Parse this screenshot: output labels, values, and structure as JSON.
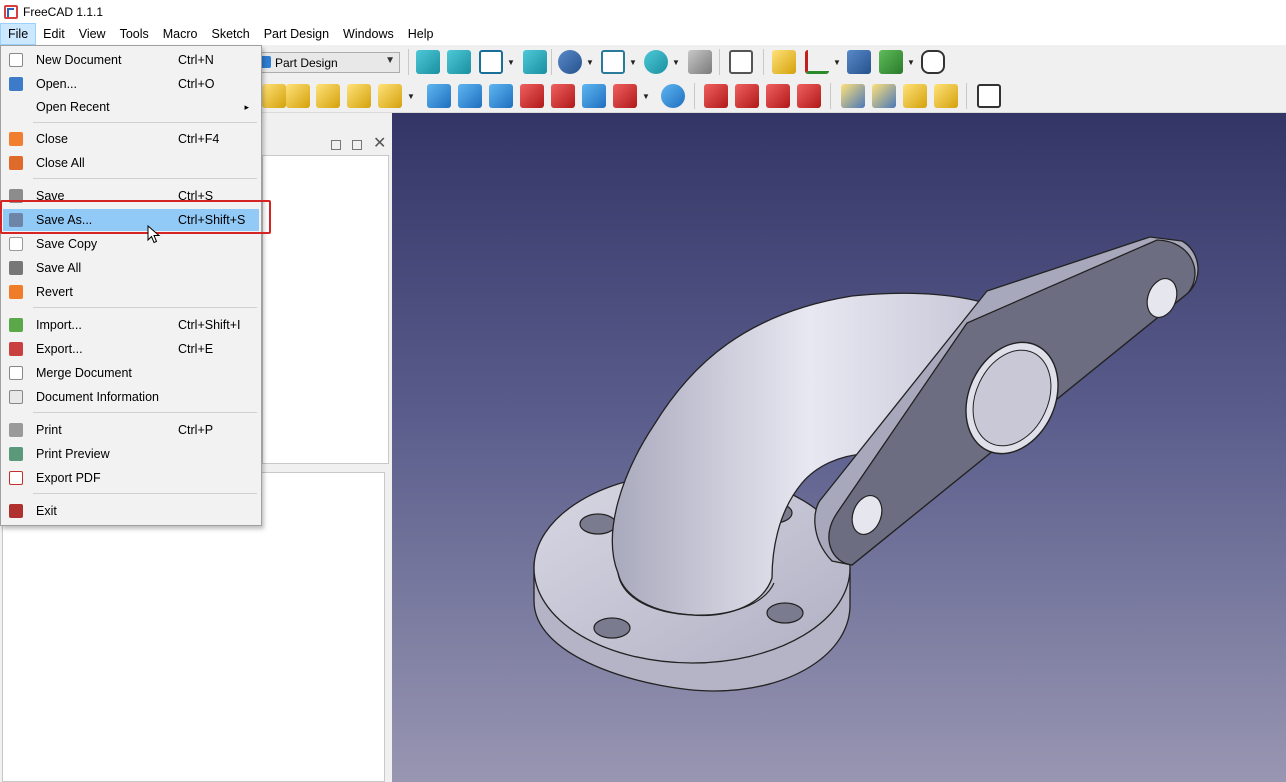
{
  "window": {
    "title": "FreeCAD 1.1.1"
  },
  "menubar": {
    "items": [
      {
        "label": "File"
      },
      {
        "label": "Edit"
      },
      {
        "label": "View"
      },
      {
        "label": "Tools"
      },
      {
        "label": "Macro"
      },
      {
        "label": "Sketch"
      },
      {
        "label": "Part Design"
      },
      {
        "label": "Windows"
      },
      {
        "label": "Help"
      }
    ],
    "active": "File"
  },
  "toolbar": {
    "workbench_selector": {
      "value": "Part Design"
    }
  },
  "file_menu": {
    "items": [
      {
        "label": "New Document",
        "shortcut": "Ctrl+N",
        "icon": "new-document-icon"
      },
      {
        "label": "Open...",
        "shortcut": "Ctrl+O",
        "icon": "open-folder-icon"
      },
      {
        "label": "Open Recent",
        "shortcut": "",
        "icon": "",
        "submenu_arrow": "▸"
      },
      {
        "label": "Close",
        "shortcut": "Ctrl+F4",
        "icon": "close-document-icon"
      },
      {
        "label": "Close All",
        "shortcut": "",
        "icon": "close-all-icon"
      },
      {
        "label": "Save",
        "shortcut": "Ctrl+S",
        "icon": "save-icon"
      },
      {
        "label": "Save As...",
        "shortcut": "Ctrl+Shift+S",
        "icon": "save-as-icon",
        "highlighted": true
      },
      {
        "label": "Save Copy",
        "shortcut": "",
        "icon": "save-copy-icon"
      },
      {
        "label": "Save All",
        "shortcut": "",
        "icon": "save-all-icon"
      },
      {
        "label": "Revert",
        "shortcut": "",
        "icon": "revert-icon"
      },
      {
        "label": "Import...",
        "shortcut": "Ctrl+Shift+I",
        "icon": "import-icon"
      },
      {
        "label": "Export...",
        "shortcut": "Ctrl+E",
        "icon": "export-icon"
      },
      {
        "label": "Merge Document",
        "shortcut": "",
        "icon": "merge-document-icon"
      },
      {
        "label": "Document Information",
        "shortcut": "",
        "icon": "document-info-icon"
      },
      {
        "label": "Print",
        "shortcut": "Ctrl+P",
        "icon": "print-icon"
      },
      {
        "label": "Print Preview",
        "shortcut": "",
        "icon": "print-preview-icon"
      },
      {
        "label": "Export PDF",
        "shortcut": "",
        "icon": "export-pdf-icon"
      },
      {
        "label": "Exit",
        "shortcut": "",
        "icon": "exit-icon"
      }
    ]
  },
  "colors": {
    "highlight": "#91c9f7",
    "callout": "#d42424",
    "viewport_top": "#333566",
    "viewport_bottom": "#9896b2",
    "model": "#c9c9d8"
  }
}
